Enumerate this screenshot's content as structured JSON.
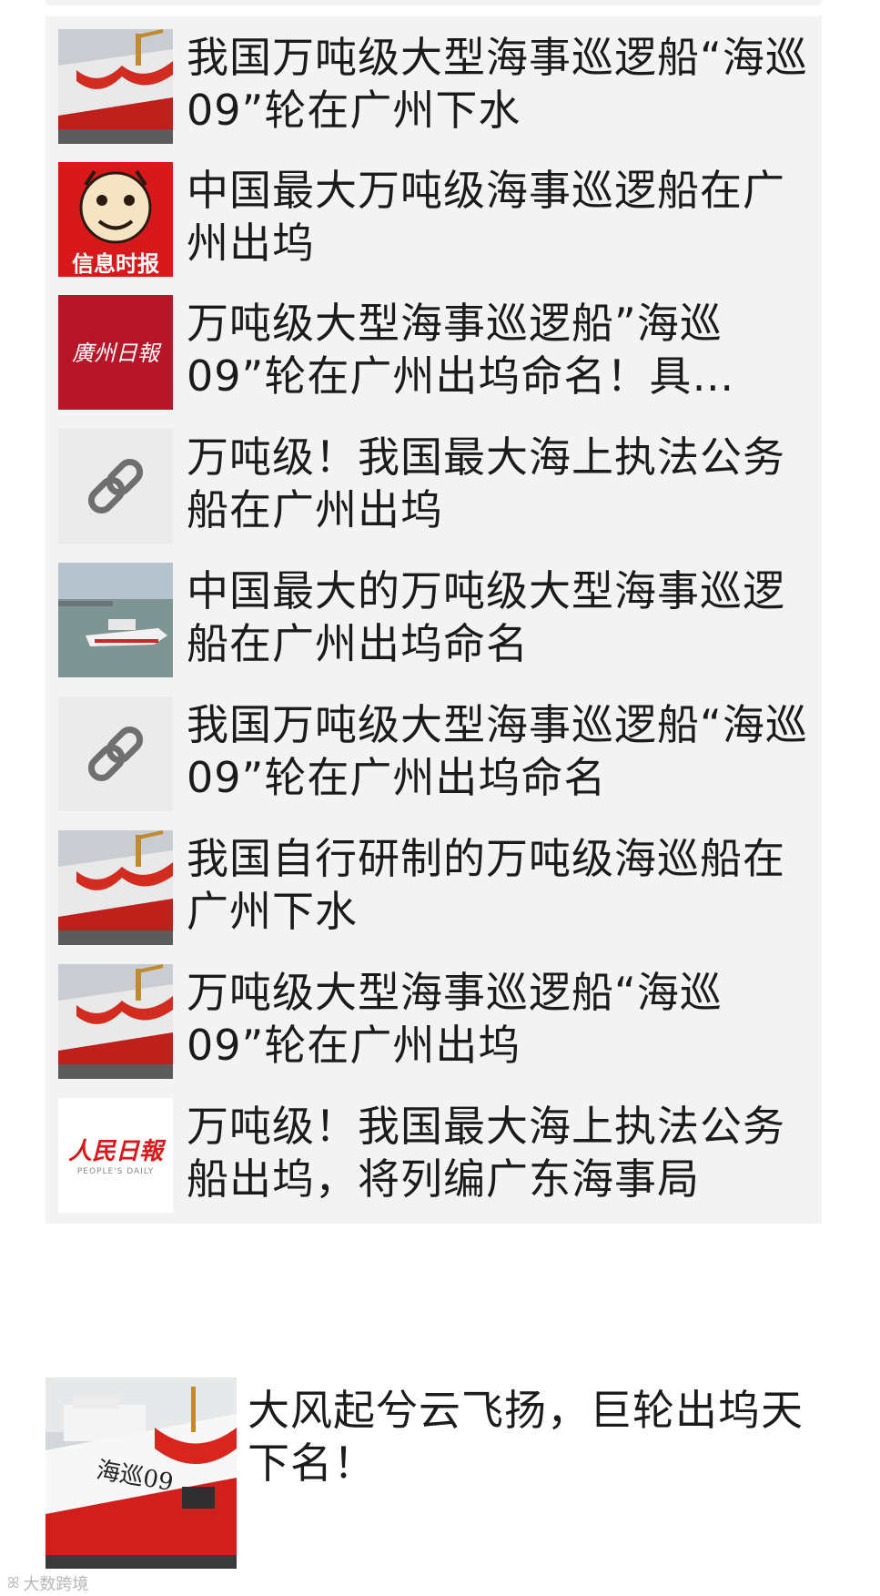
{
  "articles": [
    {
      "title": "我国万吨级大型海事巡逻船“海巡09”轮在广州下水",
      "thumb": "ship-launch-photo"
    },
    {
      "title": "中国最大万吨级海事巡逻船在广州出坞",
      "thumb": "info-times-logo",
      "logo_text": "信息时报"
    },
    {
      "title": "万吨级大型海事巡逻船”海巡09”轮在广州出坞命名！具…",
      "thumb": "guangzhou-daily-logo",
      "logo_text": "廣州日報"
    },
    {
      "title": "万吨级！我国最大海上执法公务船在广州出坞",
      "thumb": "link-icon"
    },
    {
      "title": "中国最大的万吨级大型海事巡逻船在广州出坞命名",
      "thumb": "ship-at-sea-photo"
    },
    {
      "title": "我国万吨级大型海事巡逻船“海巡09”轮在广州出坞命名",
      "thumb": "link-icon"
    },
    {
      "title": "我国自行研制的万吨级海巡船在广州下水",
      "thumb": "ship-launch-photo"
    },
    {
      "title": "万吨级大型海事巡逻船“海巡09”轮在广州出坞",
      "thumb": "ship-launch-photo"
    },
    {
      "title": "万吨级！我国最大海上执法公务船出坞，将列编广东海事局",
      "thumb": "peoples-daily-logo",
      "logo_text": "人民日報",
      "logo_sub": "PEOPLE'S DAILY"
    }
  ],
  "featured": {
    "title": "大风起兮云飞扬，巨轮出坞天下名！",
    "hull_text": "海巡09"
  },
  "watermark": {
    "text": "大数跨境"
  },
  "colors": {
    "card_bg": "#f3f3f3",
    "text": "#1b1b1b",
    "accent_red": "#d8191c"
  }
}
